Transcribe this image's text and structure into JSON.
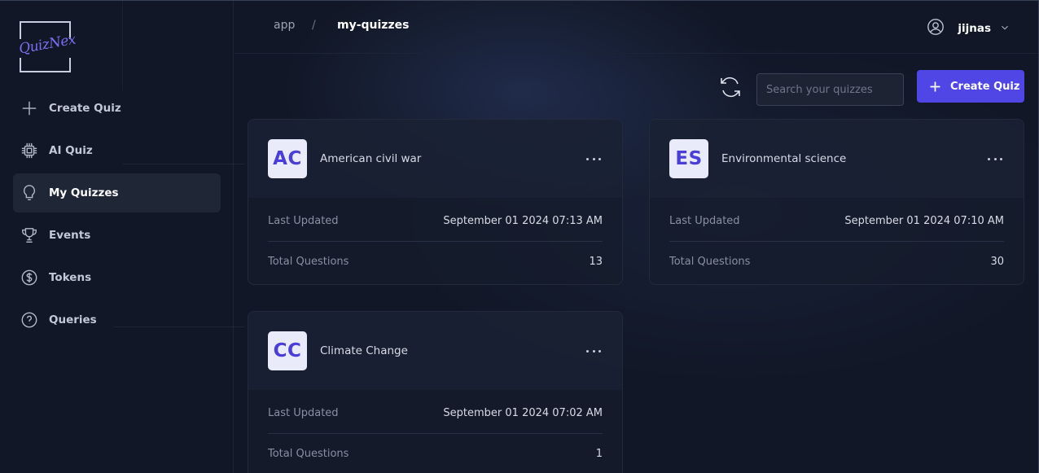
{
  "logo": {
    "text": "QuizNex"
  },
  "sidebar": {
    "items": [
      {
        "label": "Create Quiz",
        "icon": "plus-icon"
      },
      {
        "label": "AI Quiz",
        "icon": "chip-icon"
      },
      {
        "label": "My Quizzes",
        "icon": "lightbulb-icon",
        "active": true
      },
      {
        "label": "Events",
        "icon": "trophy-icon"
      },
      {
        "label": "Tokens",
        "icon": "dollar-coin-icon"
      },
      {
        "label": "Queries",
        "icon": "question-circle-icon"
      }
    ]
  },
  "header": {
    "breadcrumb": [
      "app",
      "/",
      "my-quizzes"
    ],
    "user": {
      "name": "jijnas"
    }
  },
  "toolbar": {
    "search_placeholder": "Search your quizzes",
    "search_value": "",
    "create_label": "Create Quiz"
  },
  "quizzes": [
    {
      "initials": "AC",
      "title": "American civil war",
      "last_updated_label": "Last Updated",
      "last_updated": "September 01 2024 07:13 AM",
      "questions_label": "Total Questions",
      "questions": "13"
    },
    {
      "initials": "ES",
      "title": "Environmental science",
      "last_updated_label": "Last Updated",
      "last_updated": "September 01 2024 07:10 AM",
      "questions_label": "Total Questions",
      "questions": "30"
    },
    {
      "initials": "CC",
      "title": "Climate Change",
      "last_updated_label": "Last Updated",
      "last_updated": "September 01 2024 07:02 AM",
      "questions_label": "Total Questions",
      "questions": "1"
    }
  ],
  "colors": {
    "accent": "#5046e5",
    "badge_bg": "#e9ebfa",
    "badge_text": "#4b3ed8",
    "background": "#111726"
  }
}
